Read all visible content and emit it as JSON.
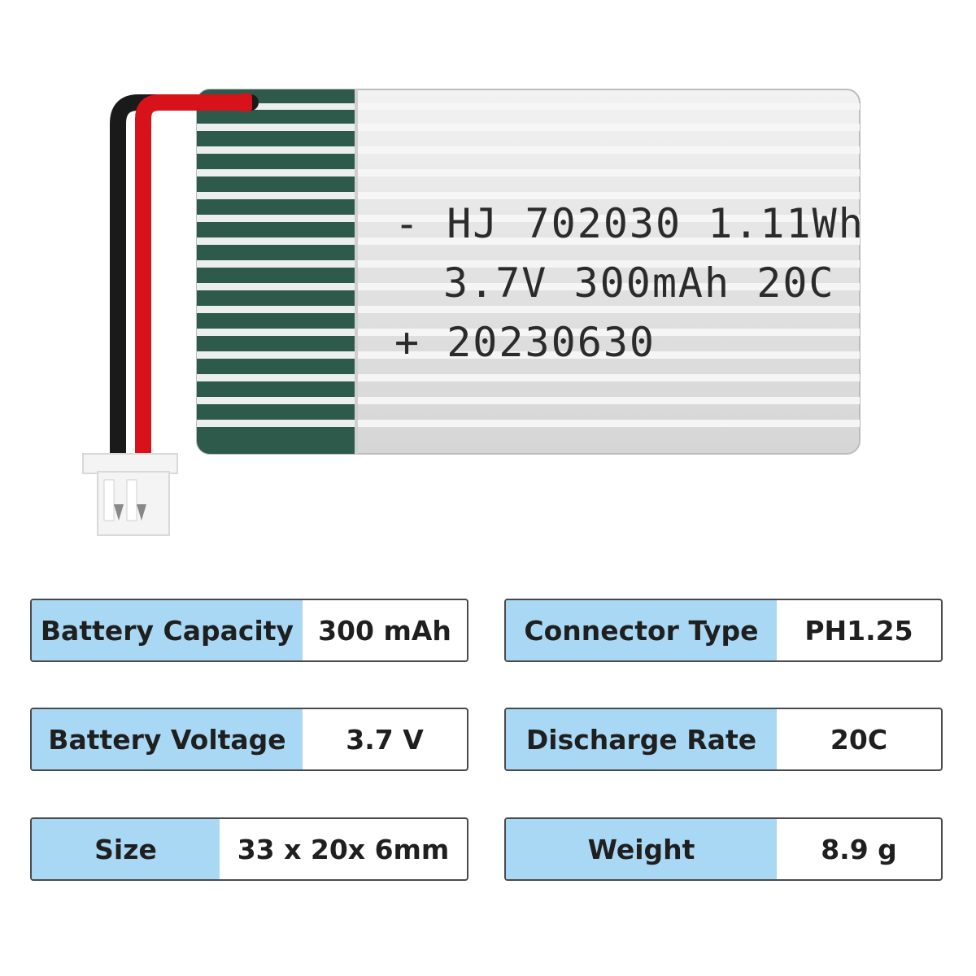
{
  "battery": {
    "label_line1": "- HJ 702030 1.11Wh",
    "label_line2": "3.7V 300mAh 20C",
    "label_line3": "+ 20230630",
    "colors": {
      "wrap_silver": "#e6e6e6",
      "stripe_green": "#2e5a4c",
      "wire_red": "#d8121b",
      "wire_black": "#1a1a1a",
      "connector_white": "#f4f4f4"
    }
  },
  "specs": [
    {
      "label": "Battery Capacity",
      "value": "300 mAh"
    },
    {
      "label": "Connector Type",
      "value": "PH1.25"
    },
    {
      "label": "Battery Voltage",
      "value": "3.7 V"
    },
    {
      "label": "Discharge Rate",
      "value": "20C"
    },
    {
      "label": "Size",
      "value": "33 x 20x 6mm"
    },
    {
      "label": "Weight",
      "value": "8.9 g"
    }
  ],
  "colors": {
    "label_bg": "#a9d8f4",
    "border": "#4a4a4a",
    "text": "#1f1f1f"
  }
}
